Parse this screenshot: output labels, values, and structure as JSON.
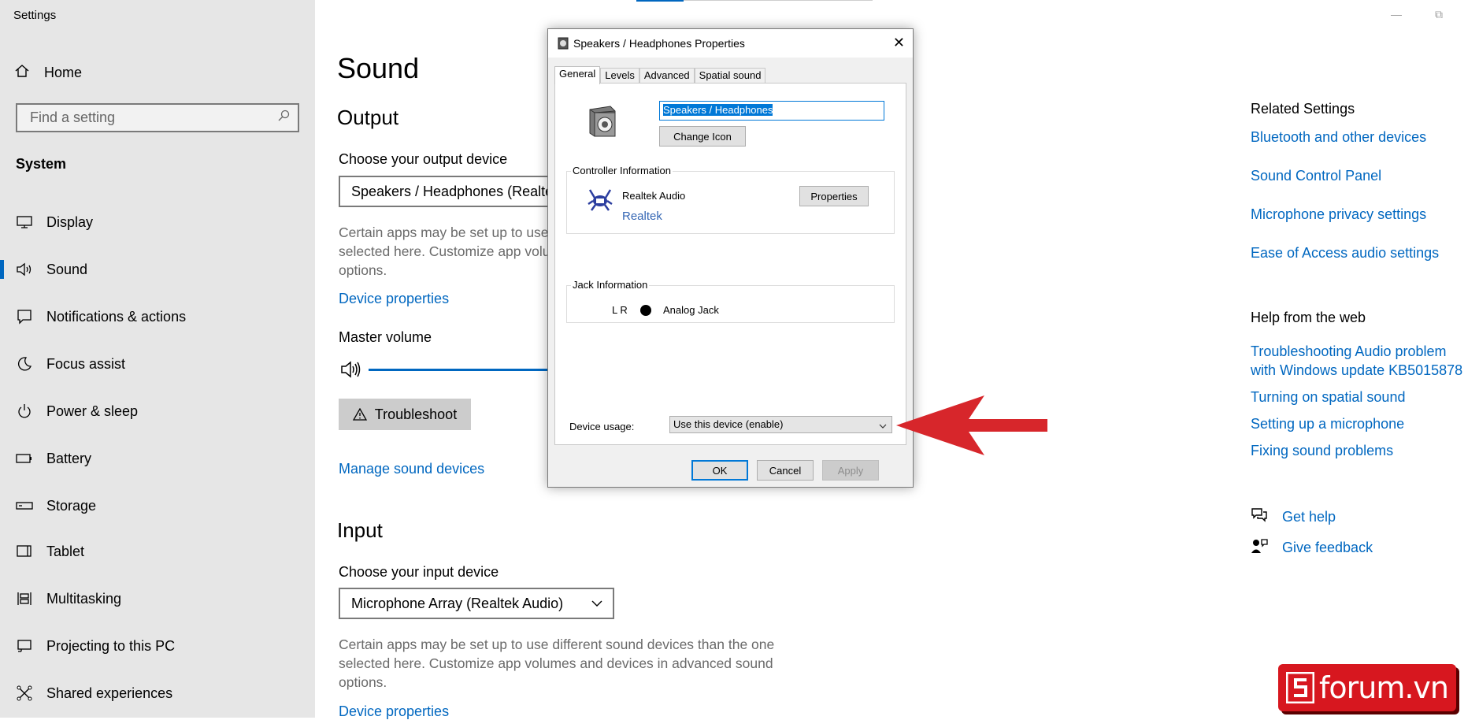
{
  "app": {
    "title": "Settings"
  },
  "sidebar": {
    "home_label": "Home",
    "search_placeholder": "Find a setting",
    "section": "System",
    "items": [
      {
        "label": "Display",
        "icon": "monitor-icon",
        "selected": false
      },
      {
        "label": "Sound",
        "icon": "speaker-icon",
        "selected": true
      },
      {
        "label": "Notifications & actions",
        "icon": "notification-icon",
        "selected": false
      },
      {
        "label": "Focus assist",
        "icon": "moon-icon",
        "selected": false
      },
      {
        "label": "Power & sleep",
        "icon": "power-icon",
        "selected": false
      },
      {
        "label": "Battery",
        "icon": "battery-icon",
        "selected": false
      },
      {
        "label": "Storage",
        "icon": "storage-icon",
        "selected": false
      },
      {
        "label": "Tablet",
        "icon": "tablet-icon",
        "selected": false
      },
      {
        "label": "Multitasking",
        "icon": "multitasking-icon",
        "selected": false
      },
      {
        "label": "Projecting to this PC",
        "icon": "projector-icon",
        "selected": false
      },
      {
        "label": "Shared experiences",
        "icon": "share-icon",
        "selected": false
      }
    ]
  },
  "main": {
    "title": "Sound",
    "output": {
      "heading": "Output",
      "device_label": "Choose your output device",
      "device_value": "Speakers / Headphones (Realtek Audio)",
      "description": "Certain apps may be set up to use different sound devices than the one selected here. Customize app volumes and devices in advanced sound options.",
      "device_properties": "Device properties",
      "master_volume": "Master volume",
      "troubleshoot": "Troubleshoot",
      "manage": "Manage sound devices"
    },
    "input": {
      "heading": "Input",
      "device_label": "Choose your input device",
      "device_value": "Microphone Array (Realtek Audio)",
      "description": "Certain apps may be set up to use different sound devices than the one selected here. Customize app volumes and devices in advanced sound options.",
      "device_properties": "Device properties"
    }
  },
  "related": {
    "heading": "Related Settings",
    "links": [
      "Bluetooth and other devices",
      "Sound Control Panel",
      "Microphone privacy settings",
      "Ease of Access audio settings"
    ]
  },
  "help": {
    "heading": "Help from the web",
    "links": [
      "Troubleshooting Audio problem with Windows update KB5015878",
      "Turning on spatial sound",
      "Setting up a microphone",
      "Fixing sound problems"
    ],
    "get_help": "Get help",
    "give_feedback": "Give feedback"
  },
  "dialog": {
    "title": "Speakers / Headphones Properties",
    "tabs": [
      "General",
      "Levels",
      "Advanced",
      "Spatial sound"
    ],
    "active_tab": "General",
    "name_value": "Speakers / Headphones",
    "change_icon": "Change Icon",
    "controller_caption": "Controller Information",
    "controller_name": "Realtek Audio",
    "controller_link": "Realtek",
    "properties_btn": "Properties",
    "jack_caption": "Jack Information",
    "jack_lr": "L R",
    "jack_type": "Analog Jack",
    "usage_label": "Device usage:",
    "usage_value": "Use this device (enable)",
    "ok": "OK",
    "cancel": "Cancel",
    "apply": "Apply"
  },
  "watermark": {
    "text": "forum.vn",
    "color": "#d7171f"
  },
  "colors": {
    "accent": "#0067c0",
    "arrow": "#d7262b"
  }
}
